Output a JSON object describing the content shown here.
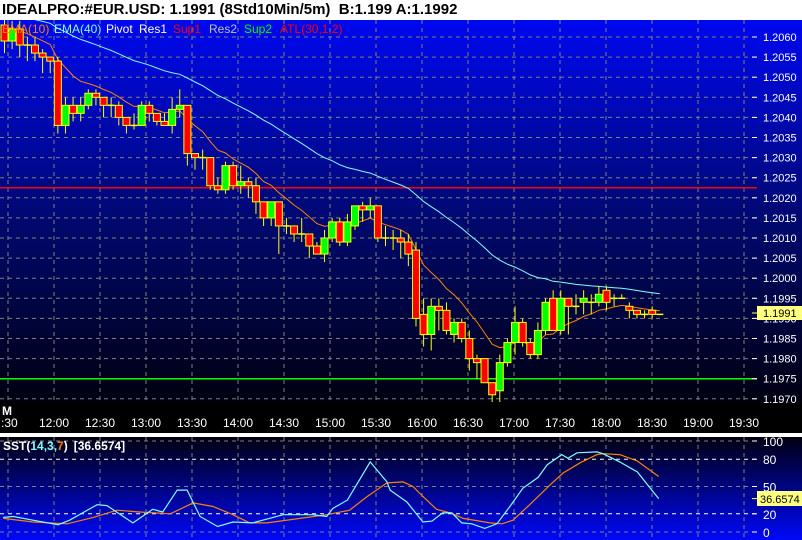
{
  "title": "IDEALPRO:#EUR.USD: 1.1991 (8Std10Min/5m)  B:1.199 A:1.1992",
  "legend": [
    {
      "label": "EMA(10)",
      "color": "#ff8000"
    },
    {
      "label": "EMA(40)",
      "color": "#80ffff"
    },
    {
      "label": "Pivot",
      "color": "#ffffff"
    },
    {
      "label": "Res1",
      "color": "#ffffff"
    },
    {
      "label": "Sup1",
      "color": "#ff0000"
    },
    {
      "label": "Res2",
      "color": "#c0c0c0"
    },
    {
      "label": "Sup2",
      "color": "#00ff00"
    },
    {
      "label": "ATL(30,1,2)",
      "color": "#ff0000"
    }
  ],
  "colors": {
    "bull": "#00ff00",
    "bear": "#ff0000",
    "outline": "#ffff00",
    "ema10": "#ff8000",
    "ema40": "#80ffff",
    "sst_k": "#80ffff",
    "sst_d": "#ff8000",
    "price_box": "#ffff80"
  },
  "period_label": "M",
  "current_price": "1.1991",
  "chart_data": [
    {
      "type": "candlestick",
      "title": "IDEALPRO:#EUR.USD 5m",
      "price_axis": [
        "1.2060",
        "1.2055",
        "1.2050",
        "1.2045",
        "1.2040",
        "1.2035",
        "1.2030",
        "1.2025",
        "1.2020",
        "1.2015",
        "1.2010",
        "1.2005",
        "1.2000",
        "1.1995",
        "1.1990",
        "1.1985",
        "1.1980",
        "1.1975",
        "1.1970"
      ],
      "ylim": [
        1.19675,
        1.2066
      ],
      "time_axis": [
        ":30",
        "12:00",
        "12:30",
        "13:00",
        "13:30",
        "14:00",
        "14:30",
        "15:00",
        "15:30",
        "16:00",
        "16:30",
        "17:00",
        "17:30",
        "18:00",
        "18:30",
        "19:00",
        "19:30"
      ],
      "hlines": [
        {
          "name": "Sup1",
          "value": 1.20225,
          "color": "#ff0000"
        },
        {
          "name": "Sup2",
          "value": 1.1975,
          "color": "#00ff00"
        }
      ],
      "ema10_seed": 1.2063,
      "ema40_seed": 1.2066,
      "ohlc": [
        [
          1.2063,
          1.2065,
          1.2056,
          1.2059
        ],
        [
          1.2059,
          1.2064,
          1.2057,
          1.2062
        ],
        [
          1.2062,
          1.2064,
          1.2055,
          1.2058
        ],
        [
          1.2058,
          1.206,
          1.2054,
          1.2058
        ],
        [
          1.2058,
          1.206,
          1.2054,
          1.2056
        ],
        [
          1.2056,
          1.2057,
          1.2051,
          1.2055
        ],
        [
          1.2055,
          1.2055,
          1.2051,
          1.2054
        ],
        [
          1.2054,
          1.2055,
          1.2036,
          1.2038
        ],
        [
          1.2038,
          1.2045,
          1.2036,
          1.2043
        ],
        [
          1.2043,
          1.2045,
          1.2039,
          1.2041
        ],
        [
          1.2041,
          1.2045,
          1.2039,
          1.2043
        ],
        [
          1.2043,
          1.2047,
          1.2042,
          1.2046
        ],
        [
          1.2046,
          1.2047,
          1.2043,
          1.2045
        ],
        [
          1.2045,
          1.2045,
          1.204,
          1.2043
        ],
        [
          1.2043,
          1.2045,
          1.204,
          1.2043
        ],
        [
          1.2043,
          1.2044,
          1.2038,
          1.204
        ],
        [
          1.204,
          1.204,
          1.2036,
          1.2038
        ],
        [
          1.2038,
          1.2041,
          1.2037,
          1.2038
        ],
        [
          1.2038,
          1.2044,
          1.2038,
          1.2043
        ],
        [
          1.2043,
          1.2044,
          1.2039,
          1.2041
        ],
        [
          1.2041,
          1.2041,
          1.2038,
          1.2039
        ],
        [
          1.2039,
          1.2041,
          1.2038,
          1.2038
        ],
        [
          1.2038,
          1.2045,
          1.2036,
          1.2042
        ],
        [
          1.2042,
          1.2047,
          1.204,
          1.2043
        ],
        [
          1.2043,
          1.2043,
          1.2028,
          1.2031
        ],
        [
          1.2031,
          1.2031,
          1.2027,
          1.203
        ],
        [
          1.203,
          1.2032,
          1.2027,
          1.203
        ],
        [
          1.203,
          1.203,
          1.2022,
          1.2023
        ],
        [
          1.2023,
          1.2025,
          1.2021,
          1.2022
        ],
        [
          1.2022,
          1.2029,
          1.2021,
          1.2028
        ],
        [
          1.2028,
          1.2029,
          1.2022,
          1.2023
        ],
        [
          1.2023,
          1.2028,
          1.2021,
          1.2024
        ],
        [
          1.2024,
          1.2025,
          1.202,
          1.2023
        ],
        [
          1.2023,
          1.2025,
          1.2016,
          1.2019
        ],
        [
          1.2019,
          1.2019,
          1.2013,
          1.2015
        ],
        [
          1.2015,
          1.2019,
          1.2013,
          1.2019
        ],
        [
          1.2019,
          1.2019,
          1.2006,
          1.2013
        ],
        [
          1.2013,
          1.2015,
          1.2011,
          1.2013
        ],
        [
          1.2013,
          1.2013,
          1.2009,
          1.2011
        ],
        [
          1.2011,
          1.2015,
          1.2009,
          1.2011
        ],
        [
          1.2011,
          1.2011,
          1.2005,
          1.2008
        ],
        [
          1.2008,
          1.2009,
          1.2006,
          1.2006
        ],
        [
          1.2006,
          1.2012,
          1.2004,
          1.201
        ],
        [
          1.201,
          1.2015,
          1.2009,
          1.2014
        ],
        [
          1.2014,
          1.2015,
          1.2008,
          1.2009
        ],
        [
          1.2009,
          1.2016,
          1.2008,
          1.2014
        ],
        [
          1.2013,
          1.2018,
          1.2012,
          1.2018
        ],
        [
          1.2018,
          1.2019,
          1.2014,
          1.2017
        ],
        [
          1.2017,
          1.202,
          1.2015,
          1.2018
        ],
        [
          1.2018,
          1.2018,
          1.2009,
          1.201
        ],
        [
          1.201,
          1.2013,
          1.2008,
          1.201
        ],
        [
          1.201,
          1.2012,
          1.2007,
          1.201
        ],
        [
          1.201,
          1.2012,
          1.2005,
          1.2009
        ],
        [
          1.2009,
          1.2011,
          1.2003,
          1.2006
        ],
        [
          1.2007,
          1.2009,
          1.1988,
          1.199
        ],
        [
          1.1991,
          1.1995,
          1.1983,
          1.1986
        ],
        [
          1.1986,
          1.1995,
          1.1982,
          1.1993
        ],
        [
          1.1993,
          1.1995,
          1.1987,
          1.1992
        ],
        [
          1.1992,
          1.1994,
          1.1986,
          1.1987
        ],
        [
          1.1986,
          1.199,
          1.1984,
          1.1989
        ],
        [
          1.1989,
          1.199,
          1.1984,
          1.1985
        ],
        [
          1.1985,
          1.1987,
          1.1977,
          1.198
        ],
        [
          1.198,
          1.1981,
          1.1975,
          1.1979
        ],
        [
          1.198,
          1.198,
          1.1974,
          1.1974
        ],
        [
          1.1974,
          1.1974,
          1.1968,
          1.1971
        ],
        [
          1.1972,
          1.1981,
          1.1969,
          1.1979
        ],
        [
          1.1979,
          1.1985,
          1.1978,
          1.1984
        ],
        [
          1.1984,
          1.1993,
          1.1981,
          1.1989
        ],
        [
          1.1989,
          1.199,
          1.1983,
          1.1984
        ],
        [
          1.1984,
          1.1985,
          1.198,
          1.1981
        ],
        [
          1.1981,
          1.1989,
          1.198,
          1.1987
        ],
        [
          1.1987,
          1.1995,
          1.1986,
          1.1994
        ],
        [
          1.1995,
          1.1997,
          1.1987,
          1.1987
        ],
        [
          1.1987,
          1.1997,
          1.1986,
          1.1995
        ],
        [
          1.1995,
          1.1995,
          1.1986,
          1.1993
        ],
        [
          1.1993,
          1.1996,
          1.1991,
          1.1993
        ],
        [
          1.1994,
          1.1997,
          1.1991,
          1.1995
        ],
        [
          1.1994,
          1.1996,
          1.1991,
          1.1994
        ],
        [
          1.1994,
          1.1998,
          1.1993,
          1.1996
        ],
        [
          1.1997,
          1.1998,
          1.1992,
          1.1994
        ],
        [
          1.1995,
          1.1996,
          1.1993,
          1.1995
        ],
        [
          1.1995,
          1.1996,
          1.1995,
          1.1995
        ],
        [
          1.1993,
          1.1994,
          1.199,
          1.1992
        ],
        [
          1.1992,
          1.1992,
          1.199,
          1.1991
        ],
        [
          1.1991,
          1.1992,
          1.199,
          1.1991
        ],
        [
          1.1992,
          1.1993,
          1.199,
          1.1991
        ],
        [
          1.1991,
          1.1991,
          1.1991,
          1.1991
        ]
      ]
    },
    {
      "type": "line",
      "title": "SST",
      "label_prefix": "SST(",
      "label_k": "14,3,",
      "label_d": "7",
      "label_suffix": ")",
      "label_value": "[36.6574]",
      "current_value": "36.6574",
      "axis_labels": [
        "100",
        "80",
        "50",
        "20",
        "0"
      ],
      "ylim": [
        0,
        100
      ],
      "x_unit": "bar index",
      "series": [
        {
          "name": "K",
          "points": [
            [
              -0.1,
              16
            ],
            [
              1.2,
              17
            ],
            [
              3.8,
              13
            ],
            [
              7.1,
              8
            ],
            [
              8.6,
              13
            ],
            [
              12.2,
              30
            ],
            [
              13.5,
              29
            ],
            [
              16.9,
              10
            ],
            [
              19.5,
              25
            ],
            [
              20.8,
              22
            ],
            [
              22.7,
              46
            ],
            [
              24,
              46
            ],
            [
              25.7,
              17
            ],
            [
              28,
              6
            ],
            [
              30,
              11
            ],
            [
              32.6,
              10
            ],
            [
              36.6,
              19
            ],
            [
              40.5,
              19
            ],
            [
              42.3,
              17
            ],
            [
              43.1,
              26
            ],
            [
              45,
              35
            ],
            [
              48,
              77
            ],
            [
              50.2,
              55
            ],
            [
              50.6,
              46
            ],
            [
              52.8,
              33
            ],
            [
              54.9,
              11
            ],
            [
              56.1,
              12
            ],
            [
              57.5,
              21
            ],
            [
              58.7,
              21
            ],
            [
              60,
              10
            ],
            [
              61.3,
              9
            ],
            [
              63,
              4
            ],
            [
              64.6,
              9
            ],
            [
              66.3,
              28
            ],
            [
              68,
              48
            ],
            [
              70,
              60
            ],
            [
              71.2,
              74
            ],
            [
              73.1,
              85
            ],
            [
              73.9,
              81
            ],
            [
              75.1,
              87
            ],
            [
              77.7,
              88
            ],
            [
              78.5,
              86
            ],
            [
              80.7,
              77
            ],
            [
              83,
              66
            ],
            [
              84.7,
              48
            ],
            [
              85.8,
              36.66
            ]
          ]
        },
        {
          "name": "D",
          "points": [
            [
              -0.1,
              15
            ],
            [
              3.8,
              11
            ],
            [
              8.3,
              9
            ],
            [
              11.7,
              16
            ],
            [
              14.8,
              24
            ],
            [
              17.8,
              22
            ],
            [
              21.8,
              20
            ],
            [
              24.8,
              32
            ],
            [
              27.4,
              28
            ],
            [
              30,
              19
            ],
            [
              32.2,
              10
            ],
            [
              34.5,
              10
            ],
            [
              38.8,
              15
            ],
            [
              42.3,
              19
            ],
            [
              45.3,
              24
            ],
            [
              47.6,
              39
            ],
            [
              50.2,
              54
            ],
            [
              52.3,
              55
            ],
            [
              53.6,
              50
            ],
            [
              54.9,
              39
            ],
            [
              56.7,
              25
            ],
            [
              58.5,
              21
            ],
            [
              60.2,
              15
            ],
            [
              63.7,
              10
            ],
            [
              65.3,
              9
            ],
            [
              66.7,
              13
            ],
            [
              68.9,
              30
            ],
            [
              71.6,
              52
            ],
            [
              73.3,
              65
            ],
            [
              75.5,
              76
            ],
            [
              77.7,
              85
            ],
            [
              78.5,
              86
            ],
            [
              80.7,
              85
            ],
            [
              83,
              78
            ],
            [
              85.8,
              61
            ]
          ]
        }
      ]
    }
  ]
}
